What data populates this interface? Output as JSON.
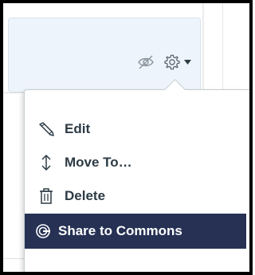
{
  "header": {
    "unpublished_icon": "unpublished-eye-slash-icon",
    "settings_icon": "gear-icon",
    "settings_caret": "caret-down-icon"
  },
  "menu": {
    "items": [
      {
        "label": "Edit",
        "icon": "pencil-icon"
      },
      {
        "label": "Move To…",
        "icon": "move-arrows-icon"
      },
      {
        "label": "Delete",
        "icon": "trash-icon"
      },
      {
        "label": "Share to Commons",
        "icon": "commons-share-icon",
        "highlighted": true
      }
    ]
  },
  "colors": {
    "panel_bg": "#eef4fb",
    "menu_text": "#2d3b45",
    "highlight_bg": "#263154",
    "highlight_text": "#ffffff"
  }
}
